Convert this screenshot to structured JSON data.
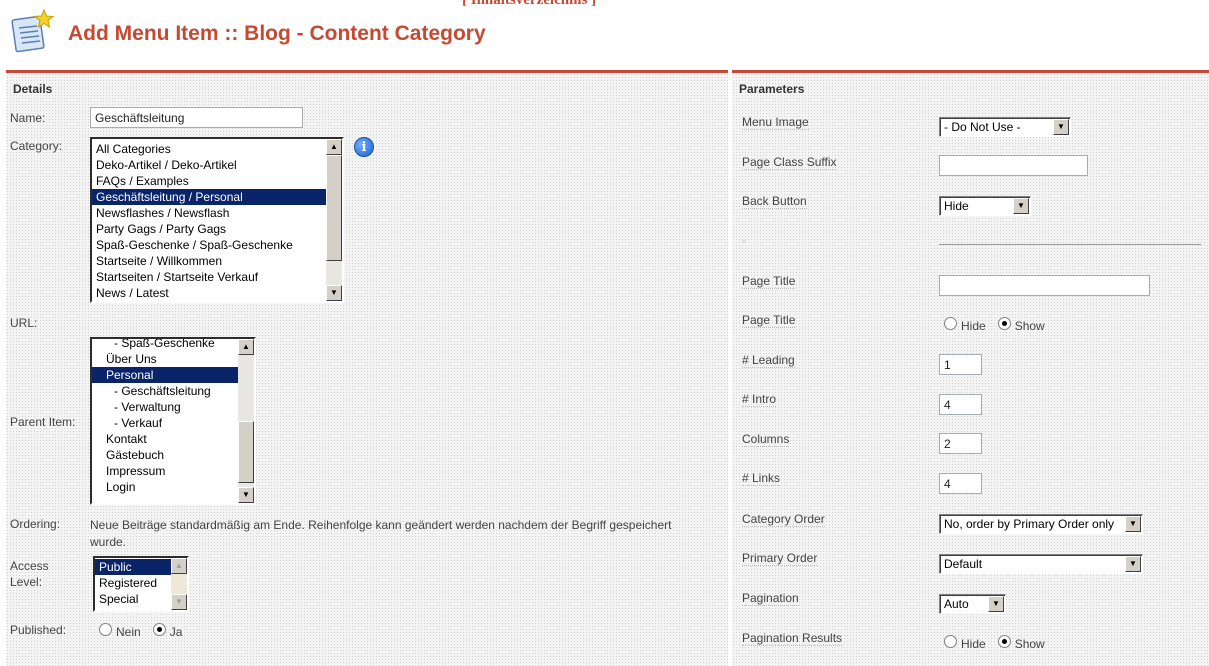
{
  "top_link": "[ Inhaltsverzeichnis ]",
  "title": "Add Menu Item :: Blog - Content Category",
  "details": {
    "heading": "Details",
    "name_label": "Name:",
    "name_value": "Geschäftsleitung",
    "category_label": "Category:",
    "categories": [
      "All Categories",
      "Deko-Artikel / Deko-Artikel",
      "FAQs / Examples",
      "Geschäftsleitung / Personal",
      "Newsflashes / Newsflash",
      "Party Gags / Party Gags",
      "Spaß-Geschenke / Spaß-Geschenke",
      "Startseite / Willkommen",
      "Startseiten / Startseite Verkauf",
      "News / Latest"
    ],
    "category_selected_index": 3,
    "url_label": "URL:",
    "parent_label": "Parent Item:",
    "parents": [
      "- Spaß-Geschenke",
      "Über Uns",
      "Personal",
      "- Geschäftsleitung",
      "- Verwaltung",
      "- Verkauf",
      "Kontakt",
      "Gästebuch",
      "Impressum",
      "Login"
    ],
    "parent_selected_index": 2,
    "ordering_label": "Ordering:",
    "ordering_text": "Neue Beiträge standardmäßig am Ende. Reihenfolge kann geändert werden nachdem der Begriff gespeichert wurde.",
    "access_label_1": "Access",
    "access_label_2": "Level:",
    "access_levels": [
      "Public",
      "Registered",
      "Special"
    ],
    "access_selected_index": 0,
    "published_label": "Published:",
    "published_no": "Nein",
    "published_yes": "Ja",
    "published_value": "Ja"
  },
  "parameters": {
    "heading": "Parameters",
    "menu_image_label": "Menu Image",
    "menu_image_value": "- Do Not Use -",
    "page_class_suffix_label": "Page Class Suffix",
    "page_class_suffix_value": "",
    "back_button_label": "Back Button",
    "back_button_value": "Hide",
    "spacer_label": "-",
    "page_title_label": "Page Title",
    "page_title_value": "",
    "page_title_show_label": "Page Title",
    "page_title_hide": "Hide",
    "page_title_show": "Show",
    "page_title_show_value": "Show",
    "leading_label": "# Leading",
    "leading_value": "1",
    "intro_label": "# Intro",
    "intro_value": "4",
    "columns_label": "Columns",
    "columns_value": "2",
    "links_label": "# Links",
    "links_value": "4",
    "category_order_label": "Category Order",
    "category_order_value": "No, order by Primary Order only",
    "primary_order_label": "Primary Order",
    "primary_order_value": "Default",
    "pagination_label": "Pagination",
    "pagination_value": "Auto",
    "pagination_results_label": "Pagination Results",
    "pagination_results_hide": "Hide",
    "pagination_results_show": "Show",
    "pagination_results_value": "Show"
  },
  "colors": {
    "accent": "#c64934",
    "selection": "#0a246a"
  }
}
